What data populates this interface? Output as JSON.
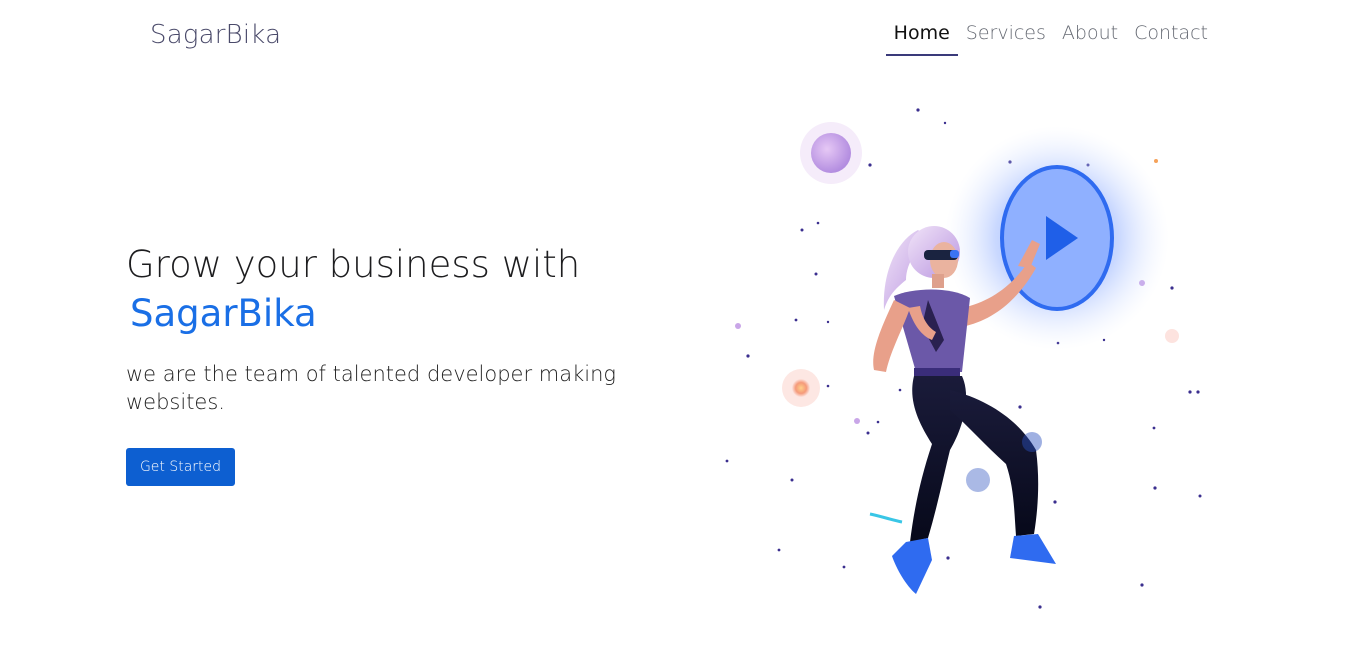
{
  "nav": {
    "brand": "SagarBika",
    "links": [
      {
        "label": "Home",
        "active": true
      },
      {
        "label": "Services",
        "active": false
      },
      {
        "label": "About",
        "active": false
      },
      {
        "label": "Contact",
        "active": false
      }
    ]
  },
  "hero": {
    "headline": "Grow your business with",
    "highlight": "SagarBika",
    "subtitle": "we are the team of talented developer making websites.",
    "cta_label": "Get Started"
  },
  "illustration": {
    "icon": "play-icon",
    "accent_color": "#1a6fe6",
    "glow_color": "#7aa0ff"
  }
}
